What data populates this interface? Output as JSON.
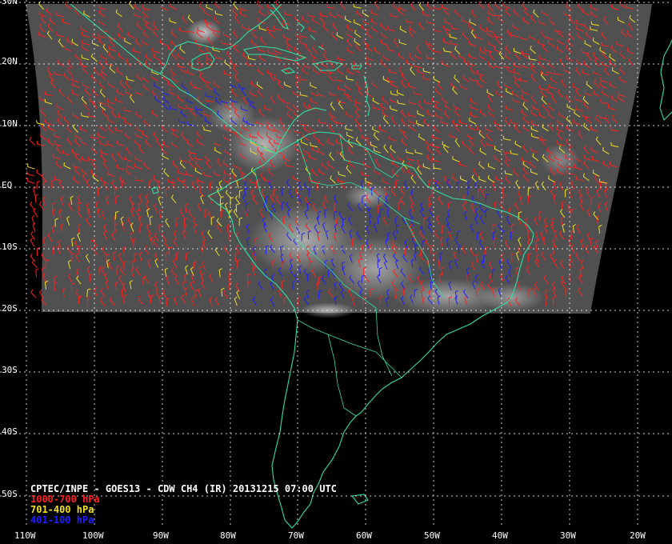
{
  "map": {
    "title": "CPTEC/INPE - GOES13 - CDW CH4 (IR) 20131215 07:00 UTC",
    "legend": [
      {
        "label": "1000-700 hPa",
        "color": "#ff2020"
      },
      {
        "label": "701-400 hPa",
        "color": "#f0e020"
      },
      {
        "label": "401-100 hPa",
        "color": "#2020ff"
      }
    ],
    "lat_labels": [
      "30N",
      "20N",
      "10N",
      "EQ",
      "10S",
      "20S",
      "30S",
      "40S",
      "50S"
    ],
    "lon_labels": [
      "110W",
      "100W",
      "90W",
      "80W",
      "70W",
      "60W",
      "50W",
      "40W",
      "30W",
      "20W"
    ],
    "colors": {
      "background": "#000000",
      "coastline": "#30e0a0",
      "grid": "#ffffff",
      "imagery": "#505050",
      "clouds": "#e8e8e8"
    }
  }
}
